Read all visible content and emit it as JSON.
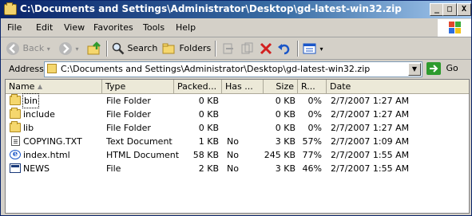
{
  "window": {
    "title": "C:\\Documents and Settings\\Administrator\\Desktop\\gd-latest-win32.zip",
    "min": "_",
    "max": "□",
    "close": "X"
  },
  "menu": [
    "File",
    "Edit",
    "View",
    "Favorites",
    "Tools",
    "Help"
  ],
  "toolbar": {
    "back": "Back",
    "search": "Search",
    "folders": "Folders"
  },
  "address": {
    "label": "Address",
    "value": "C:\\Documents and Settings\\Administrator\\Desktop\\gd-latest-win32.zip",
    "go": "Go"
  },
  "columns": [
    "Name",
    "Type",
    "Packed...",
    "Has ...",
    "Size",
    "R...",
    "Date"
  ],
  "files": [
    {
      "icon": "folder-icon",
      "name": "bin",
      "type": "File Folder",
      "packed": "0 KB",
      "has": "",
      "size": "0 KB",
      "ratio": "0%",
      "date": "2/7/2007 1:27 AM"
    },
    {
      "icon": "folder-icon",
      "name": "include",
      "type": "File Folder",
      "packed": "0 KB",
      "has": "",
      "size": "0 KB",
      "ratio": "0%",
      "date": "2/7/2007 1:27 AM"
    },
    {
      "icon": "folder-icon",
      "name": "lib",
      "type": "File Folder",
      "packed": "0 KB",
      "has": "",
      "size": "0 KB",
      "ratio": "0%",
      "date": "2/7/2007 1:27 AM"
    },
    {
      "icon": "text-document-icon",
      "name": "COPYING.TXT",
      "type": "Text Document",
      "packed": "1 KB",
      "has": "No",
      "size": "3 KB",
      "ratio": "57%",
      "date": "2/7/2007 1:09 AM"
    },
    {
      "icon": "html-document-icon",
      "name": "index.html",
      "type": "HTML Document",
      "packed": "58 KB",
      "has": "No",
      "size": "245 KB",
      "ratio": "77%",
      "date": "2/7/2007 1:55 AM"
    },
    {
      "icon": "file-icon",
      "name": "NEWS",
      "type": "File",
      "packed": "2 KB",
      "has": "No",
      "size": "3 KB",
      "ratio": "46%",
      "date": "2/7/2007 1:55 AM"
    }
  ],
  "colors": {
    "titlebar_start": "#0a246a",
    "titlebar_end": "#a6caf0",
    "chrome": "#d4d0c8",
    "delete_red": "#d21f1f",
    "go_green": "#2e9b2e"
  }
}
